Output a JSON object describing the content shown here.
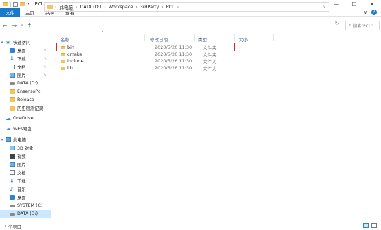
{
  "window": {
    "title": "PCL",
    "controls": [
      "—",
      "☐",
      "✕"
    ]
  },
  "ribbon": {
    "tabs": [
      "文件",
      "主页",
      "共享",
      "查看"
    ],
    "expand": "∨",
    "help": "?"
  },
  "nav": {
    "back": "←",
    "forward": "→",
    "recent": "∨",
    "up": "↑",
    "breadcrumbs": [
      "此电脑",
      "DATA (D:)",
      "Workspace",
      "3rdParty",
      "PCL"
    ],
    "separator": "›",
    "dropdown": "∨",
    "refresh": "↻",
    "search_placeholder": "搜索\"PCL\""
  },
  "sidebar": {
    "items": [
      {
        "label": "快速访问",
        "icon": "star-icon",
        "kind": "header"
      },
      {
        "label": "桌面",
        "icon": "desktop-icon",
        "pinned": true
      },
      {
        "label": "下载",
        "icon": "download-icon",
        "pinned": true
      },
      {
        "label": "文档",
        "icon": "document-icon",
        "pinned": true
      },
      {
        "label": "图片",
        "icon": "picture-icon",
        "pinned": true
      },
      {
        "label": "DATA (D:)",
        "icon": "drive-icon"
      },
      {
        "label": "EnsensoPcl",
        "icon": "folder-icon"
      },
      {
        "label": "Release",
        "icon": "folder-icon"
      },
      {
        "label": "历史检测记录",
        "icon": "folder-icon"
      },
      {
        "label": "OneDrive",
        "icon": "cloud-icon",
        "kind": "header"
      },
      {
        "label": "WPS网盘",
        "icon": "wps-cloud-icon",
        "kind": "header"
      },
      {
        "label": "此电脑",
        "icon": "computer-icon",
        "kind": "header"
      },
      {
        "label": "3D 对象",
        "icon": "3d-objects-icon"
      },
      {
        "label": "视频",
        "icon": "video-icon"
      },
      {
        "label": "图片",
        "icon": "picture-icon"
      },
      {
        "label": "文档",
        "icon": "document-icon"
      },
      {
        "label": "下载",
        "icon": "download-icon"
      },
      {
        "label": "音乐",
        "icon": "music-icon"
      },
      {
        "label": "桌面",
        "icon": "desktop-icon"
      },
      {
        "label": "SYSTEM (C:)",
        "icon": "drive-icon"
      },
      {
        "label": "DATA (D:)",
        "icon": "drive-icon",
        "selected": true
      }
    ],
    "pin_glyph": "✎"
  },
  "columns": {
    "name": "名称",
    "date": "修改日期",
    "type": "类型",
    "size": "大小",
    "sort_caret": "^"
  },
  "files": [
    {
      "name": "bin",
      "date": "2020/5/26 11:30",
      "type": "文件夹"
    },
    {
      "name": "cmake",
      "date": "2020/5/26 11:30",
      "type": "文件夹"
    },
    {
      "name": "include",
      "date": "2020/5/26 11:30",
      "type": "文件夹"
    },
    {
      "name": "lib",
      "date": "2020/5/26 11:30",
      "type": "文件夹"
    }
  ],
  "status": {
    "item_count": "4 个项目"
  },
  "colors": {
    "file_tab": "#1979ca",
    "selection": "#cce8ff",
    "highlight_box": "#e8222a",
    "folder": "#f2c55c"
  }
}
